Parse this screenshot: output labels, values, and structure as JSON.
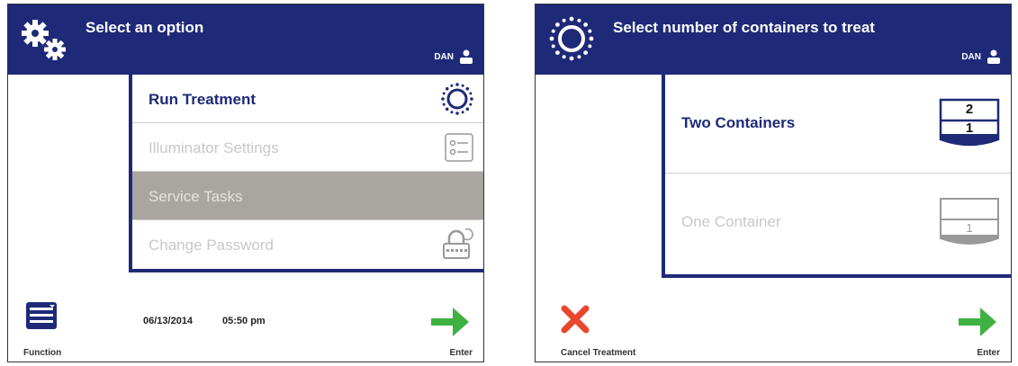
{
  "left": {
    "header": {
      "title": "Select an option",
      "user": "DAN",
      "icon": "gears-icon"
    },
    "menu": [
      {
        "label": "Run Treatment",
        "state": "enabled",
        "icon": "treatment-sun-icon"
      },
      {
        "label": "Illuminator Settings",
        "state": "disabled",
        "icon": "settings-list-icon"
      },
      {
        "label": "Service Tasks",
        "state": "selected",
        "icon": ""
      },
      {
        "label": "Change Password",
        "state": "disabled",
        "icon": "lock-password-icon"
      }
    ],
    "footer": {
      "left_label": "Function",
      "date": "06/13/2014",
      "time": "05:50 pm",
      "right_label": "Enter"
    }
  },
  "right": {
    "header": {
      "title": "Select number of containers to treat",
      "user": "DAN",
      "icon": "treatment-sun-icon"
    },
    "options": [
      {
        "label": "Two Containers",
        "state": "enabled",
        "top": "2",
        "bottom": "1"
      },
      {
        "label": "One Container",
        "state": "disabled",
        "top": "",
        "bottom": "1"
      }
    ],
    "footer": {
      "left_label": "Cancel Treatment",
      "right_label": "Enter"
    }
  },
  "colors": {
    "header": "#1e2a78",
    "enter_arrow": "#3fb142",
    "cancel_x": "#e8472d",
    "selected_row": "#a9a6a2"
  }
}
